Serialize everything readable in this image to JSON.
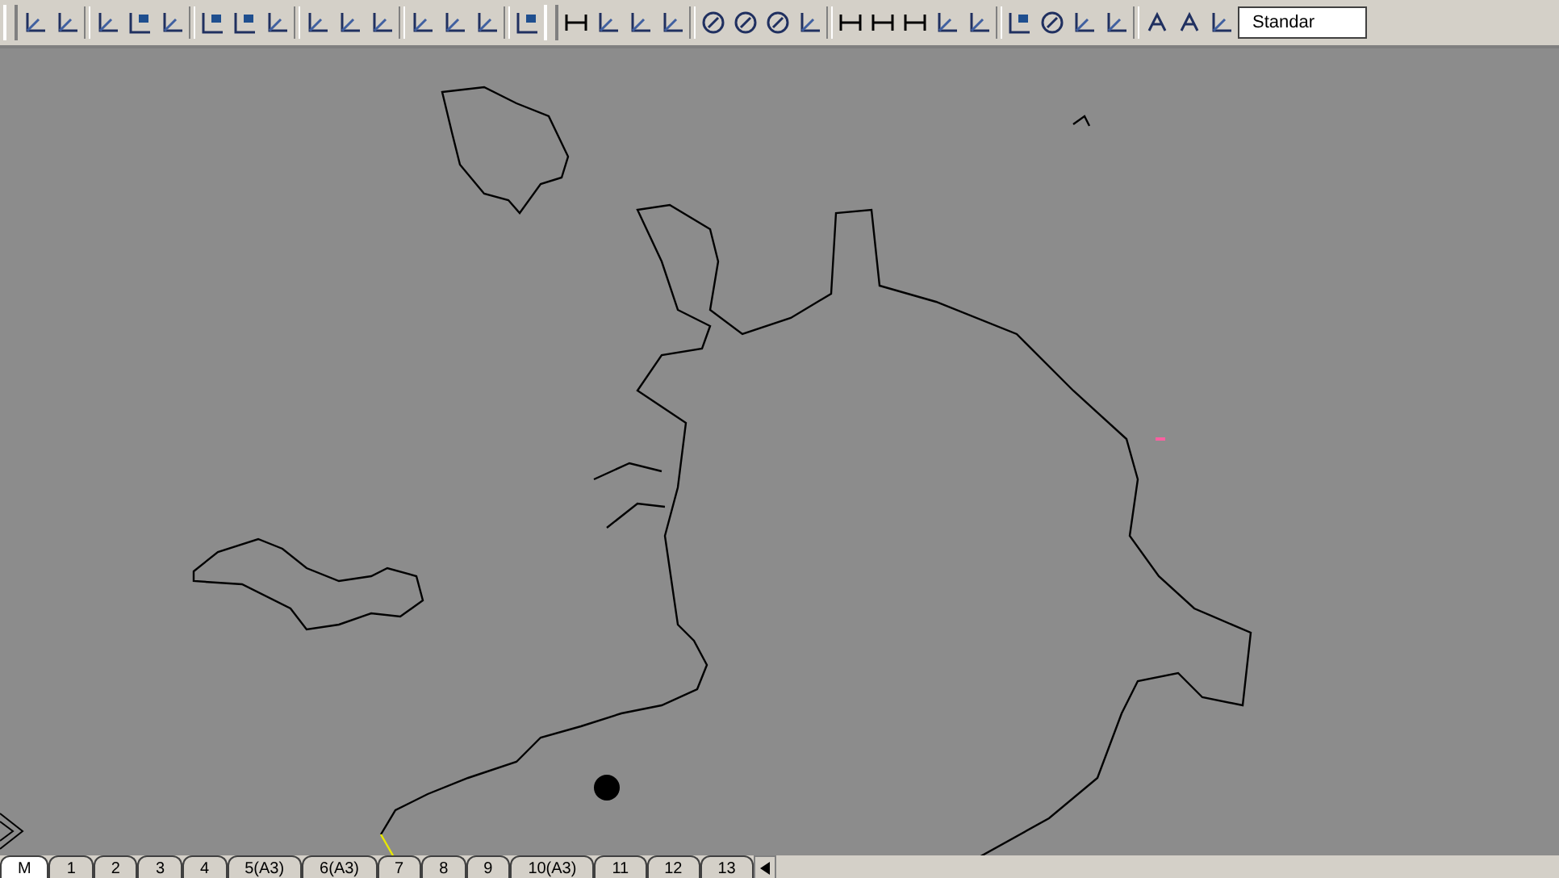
{
  "toolbar": {
    "style_field": {
      "value": "Standar"
    }
  },
  "layout_tabs": [
    {
      "label": "M",
      "selected": true
    },
    {
      "label": "1",
      "selected": false
    },
    {
      "label": "2",
      "selected": false
    },
    {
      "label": "3",
      "selected": false
    },
    {
      "label": "4",
      "selected": false
    },
    {
      "label": "5(A3)",
      "selected": false
    },
    {
      "label": "6(A3)",
      "selected": false
    },
    {
      "label": "7",
      "selected": false
    },
    {
      "label": "8",
      "selected": false
    },
    {
      "label": "9",
      "selected": false
    },
    {
      "label": "10(A3)",
      "selected": false
    },
    {
      "label": "11",
      "selected": false
    },
    {
      "label": "12",
      "selected": false
    },
    {
      "label": "13",
      "selected": false
    }
  ]
}
